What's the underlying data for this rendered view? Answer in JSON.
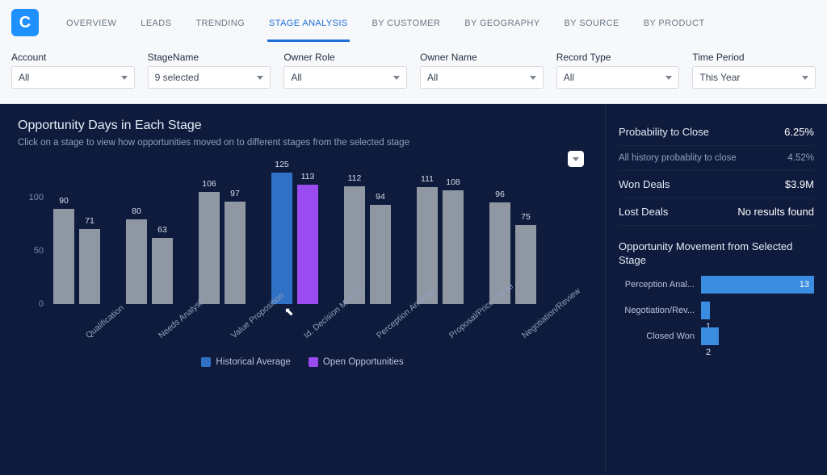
{
  "nav": {
    "tabs": [
      "OVERVIEW",
      "LEADS",
      "TRENDING",
      "STAGE ANALYSIS",
      "BY CUSTOMER",
      "BY GEOGRAPHY",
      "BY SOURCE",
      "BY PRODUCT"
    ],
    "active_index": 3
  },
  "filters": [
    {
      "label": "Account",
      "value": "All"
    },
    {
      "label": "StageName",
      "value": "9 selected"
    },
    {
      "label": "Owner Role",
      "value": "All"
    },
    {
      "label": "Owner Name",
      "value": "All"
    },
    {
      "label": "Record Type",
      "value": "All"
    },
    {
      "label": "Time Period",
      "value": "This Year"
    }
  ],
  "left_panel": {
    "title": "Opportunity Days in Each Stage",
    "subtitle": "Click on a stage to view how opportunities moved on to different stages from the selected stage",
    "legend": {
      "a": "Historical Average",
      "b": "Open Opportunities"
    }
  },
  "right_panel": {
    "metrics": [
      {
        "label": "Probability to Close",
        "value": "6.25%",
        "emph": true
      },
      {
        "label": "All history probablity to close",
        "value": "4.52%",
        "emph": false
      },
      {
        "label": "Won Deals",
        "value": "$3.9M",
        "emph": true
      },
      {
        "label": "Lost Deals",
        "value": "No results found",
        "emph": true
      }
    ],
    "section_title": "Opportunity Movement from Selected Stage"
  },
  "chart_data": {
    "type": "bar",
    "title": "Opportunity Days in Each Stage",
    "ylabel": "",
    "xlabel": "",
    "ylim": [
      0,
      130
    ],
    "yticks": [
      0,
      50,
      100
    ],
    "categories": [
      "Qualification",
      "Needs Analysis",
      "Value Proposition",
      "Id. Decision Makers",
      "Perception Analysis",
      "Proposal/Price Quote",
      "Negotiation/Review"
    ],
    "selected_category_index": 3,
    "series": [
      {
        "name": "Historical Average",
        "color": "#2f71c4",
        "values": [
          90,
          80,
          106,
          125,
          112,
          111,
          96
        ]
      },
      {
        "name": "Open Opportunities",
        "color": "#9a4cf0",
        "values": [
          71,
          63,
          97,
          113,
          94,
          108,
          75
        ]
      }
    ],
    "legend_position": "bottom"
  },
  "movement_chart": {
    "type": "bar",
    "orientation": "horizontal",
    "title": "Opportunity Movement from Selected Stage",
    "xlim": [
      0,
      13
    ],
    "categories": [
      "Perception Anal...",
      "Negotiation/Rev...",
      "Closed Won"
    ],
    "values": [
      13,
      1,
      2
    ]
  }
}
